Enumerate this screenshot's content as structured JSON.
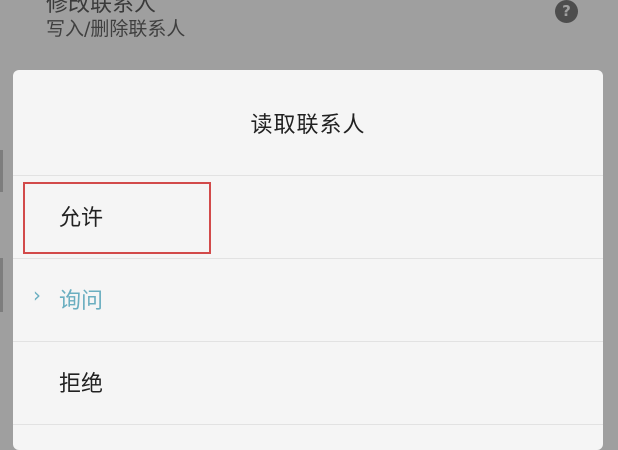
{
  "background_setting": {
    "title": "修改联系人",
    "subtitle": "写入/删除联系人",
    "help_icon": "?"
  },
  "dialog": {
    "title": "读取联系人",
    "selected_marker": "›",
    "options": [
      {
        "label": "允许"
      },
      {
        "label": "询问"
      },
      {
        "label": "拒绝"
      }
    ]
  },
  "colors": {
    "selected_accent": "#6aaec0",
    "highlight_border": "#d24a4a",
    "overlay": "#9f9f9f",
    "dialog_background": "#f5f5f5"
  }
}
